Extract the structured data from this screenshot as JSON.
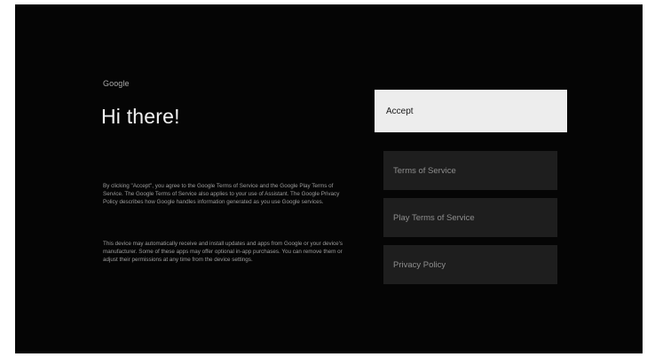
{
  "header": {
    "brand": "Google",
    "title": "Hi there!"
  },
  "body": {
    "paragraph_1": "By clicking \"Accept\", you agree to the Google Terms of Service and the Google Play Terms of Service. The Google Terms of Service also applies to your use of Assistant. The Google Privacy Policy describes how Google handles information generated as you use Google services.",
    "paragraph_2": "This device may automatically receive and install updates and apps from Google or your device's manufacturer. Some of these apps may offer optional in-app purchases. You can remove them or adjust their permissions at any time from the device settings."
  },
  "actions": {
    "accept": "Accept",
    "terms_of_service": "Terms of Service",
    "play_terms_of_service": "Play Terms of Service",
    "privacy_policy": "Privacy Policy"
  },
  "colors": {
    "background": "#050505",
    "focused_button": "#ededed",
    "option_button": "#1e1e1e"
  }
}
